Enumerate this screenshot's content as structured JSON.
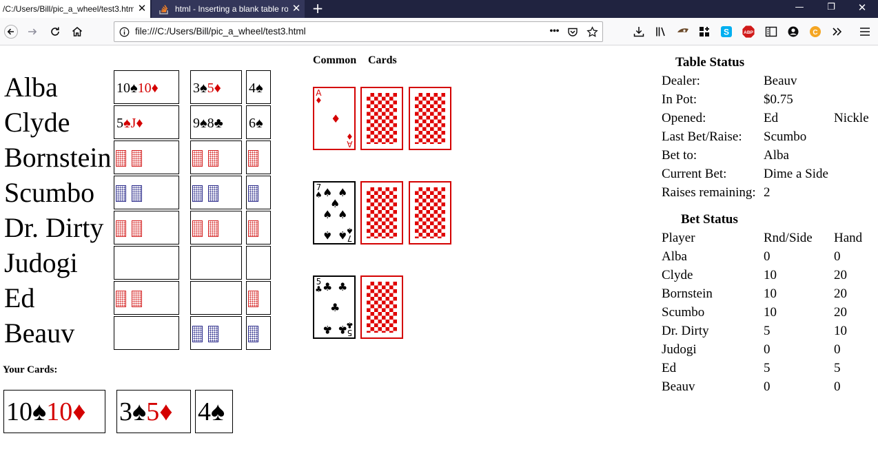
{
  "browser": {
    "tabs": [
      {
        "title": "/C:/Users/Bill/pic_a_wheel/test3.htm"
      },
      {
        "title": "html - Inserting a blank table ro"
      }
    ],
    "url": "file:///C:/Users/Bill/pic_a_wheel/test3.html",
    "icons": [
      "back-icon",
      "forward-icon",
      "reload-icon",
      "home-icon",
      "info-icon",
      "more-icon",
      "pocket-icon",
      "bookmark-star-icon",
      "downloads-icon",
      "library-icon",
      "extension-icon",
      "grid-icon",
      "skype-icon",
      "adblock-icon",
      "reader-icon",
      "account-icon",
      "coin-icon",
      "overflow-icon",
      "menu-icon"
    ],
    "badges": {
      "adblock": "ABP",
      "skype": "S",
      "coin": "C"
    }
  },
  "colors": {
    "card_red": "#d40000",
    "back_red": "#e00000",
    "back_blue": "#2a2a8a",
    "tabstrip": "#202340"
  },
  "players": [
    {
      "name": "Alba"
    },
    {
      "name": "Clyde"
    },
    {
      "name": "Bornstein"
    },
    {
      "name": "Scumbo"
    },
    {
      "name": "Dr. Dirty"
    },
    {
      "name": "Judogi"
    },
    {
      "name": "Ed"
    },
    {
      "name": "Beauv"
    }
  ],
  "hands": {
    "alba": {
      "a1": "10",
      "a2": "10",
      "b1": "3",
      "b2": "5",
      "c1": "4"
    },
    "clyde": {
      "a1": "5",
      "a2": "J",
      "b1": "9",
      "b2": "8",
      "c1": "6"
    }
  },
  "suits": {
    "spade": "♠",
    "diamond": "♦",
    "club": "♣"
  },
  "common": {
    "header1": "Common",
    "header2": "Cards",
    "cards": {
      "ace_rank": "A",
      "seven_rank": "7",
      "five_rank": "5"
    }
  },
  "your_cards": {
    "label": "Your Cards:",
    "a1": "10",
    "a2": "10",
    "b1": "3",
    "b2": "5",
    "c1": "4"
  },
  "table_status": {
    "title": "Table Status",
    "rows": [
      {
        "label": "Dealer:",
        "value": "Beauv",
        "extra": ""
      },
      {
        "label": "In Pot:",
        "value": "$0.75",
        "extra": ""
      },
      {
        "label": "Opened:",
        "value": "Ed",
        "extra": "Nickle"
      },
      {
        "label": "Last Bet/Raise:",
        "value": "Scumbo",
        "extra": ""
      },
      {
        "label": "Bet to:",
        "value": "Alba",
        "extra": ""
      },
      {
        "label": "Current Bet:",
        "value": "Dime a Side",
        "extra": ""
      },
      {
        "label": "Raises remaining:",
        "value": "2",
        "extra": ""
      }
    ]
  },
  "bet_status": {
    "title": "Bet Status",
    "headers": [
      "Player",
      "Rnd/Side",
      "Hand"
    ],
    "rows": [
      {
        "player": "Alba",
        "rnd": "0",
        "hand": "0"
      },
      {
        "player": "Clyde",
        "rnd": "10",
        "hand": "20"
      },
      {
        "player": "Bornstein",
        "rnd": "10",
        "hand": "20"
      },
      {
        "player": "Scumbo",
        "rnd": "10",
        "hand": "20"
      },
      {
        "player": "Dr. Dirty",
        "rnd": "5",
        "hand": "10"
      },
      {
        "player": "Judogi",
        "rnd": "0",
        "hand": "0"
      },
      {
        "player": "Ed",
        "rnd": "5",
        "hand": "5"
      },
      {
        "player": "Beauv",
        "rnd": "0",
        "hand": "0"
      }
    ]
  }
}
